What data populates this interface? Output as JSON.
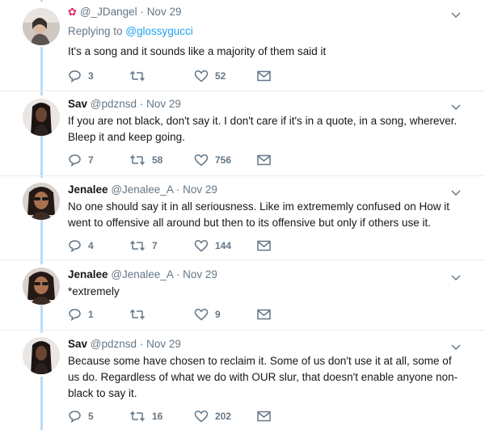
{
  "colors": {
    "thread_line": "#b8dcf7",
    "link": "#1da1f2",
    "muted": "#657786",
    "text": "#14171a",
    "flower": "#e0245e"
  },
  "tweets": [
    {
      "name": "",
      "handle": "@_JDangel",
      "separator": "·",
      "date": "Nov 29",
      "flower_icon": "✿",
      "reply_label": "Replying to",
      "reply_mention": "@glossygucci",
      "text": "It's a song and it sounds like a majority of them said it",
      "replies": "3",
      "retweets": "",
      "likes": "52"
    },
    {
      "name": "Sav",
      "handle": "@pdznsd",
      "separator": "·",
      "date": "Nov 29",
      "text": "If you are not black, don't say it. I don't care if it's in a quote, in a song, wherever. Bleep it and keep going.",
      "replies": "7",
      "retweets": "58",
      "likes": "756"
    },
    {
      "name": "Jenalee",
      "handle": "@Jenalee_A",
      "separator": "·",
      "date": "Nov 29",
      "text": "No one should say it in all seriousness. Like im extrememly confused on How it went to offensive all around but then to its offensive but only if others use it.",
      "replies": "4",
      "retweets": "7",
      "likes": "144"
    },
    {
      "name": "Jenalee",
      "handle": "@Jenalee_A",
      "separator": "·",
      "date": "Nov 29",
      "text": "*extremely",
      "replies": "1",
      "retweets": "",
      "likes": "9"
    },
    {
      "name": "Sav",
      "handle": "@pdznsd",
      "separator": "·",
      "date": "Nov 29",
      "text": "Because some have chosen to reclaim it. Some of us don't use it at all, some of us do. Regardless of what we do with OUR slur, that doesn't enable anyone non-black to say it.",
      "replies": "5",
      "retweets": "16",
      "likes": "202"
    }
  ]
}
